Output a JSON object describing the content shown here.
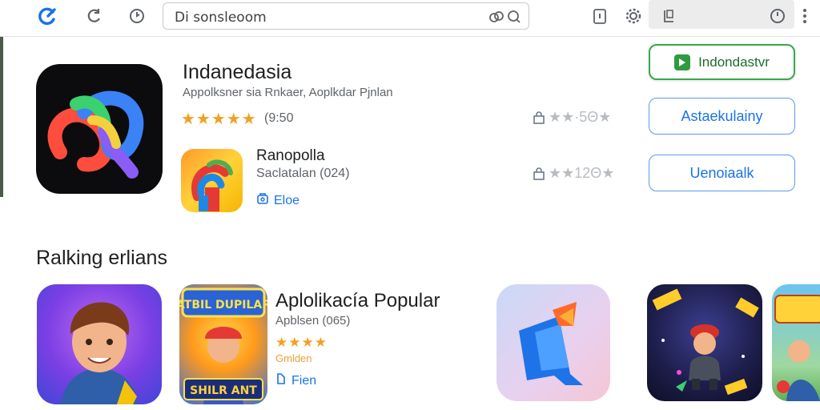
{
  "browser": {
    "address_text": "Di sonsleoom"
  },
  "hero_app": {
    "title": "Indanedasia",
    "subtitle": "Appolksner sia Rnkaer, Aoplkdar Pjnlan",
    "stars": "★★★★★",
    "rating_text": "(9:50",
    "right_rating": "★★·5Θ★"
  },
  "second_app": {
    "title": "Ranopolla",
    "subtitle": "Saclatalan (024)",
    "link_label": "Eloe",
    "right_rating": "★★12Θ★"
  },
  "buttons": {
    "primary_label": "Indondastvr",
    "secondary_label": "Astaekulainy",
    "tertiary_label": "Uenoiaalk"
  },
  "section": {
    "title": "Ralking erlians"
  },
  "popular": {
    "title": "Aplolikacía Popular",
    "subtitle": "Apblsen (065)",
    "stars": "★★★★",
    "genre": "Gmlden",
    "link_label": "Fien",
    "game_banner_text": "ATBIL DUPILAR",
    "game_footer_text": "SHILR ANT"
  },
  "colors": {
    "accent_blue": "#1a73e8",
    "star_orange": "#f2a022",
    "green": "#38a84a"
  },
  "icons": [
    "app-logo-icon",
    "reload-icon",
    "history-icon",
    "link-icon",
    "clipboard-icon",
    "gear-icon",
    "tab-icon",
    "clock-icon",
    "more-icon",
    "lock-icon",
    "gallery-icon"
  ]
}
